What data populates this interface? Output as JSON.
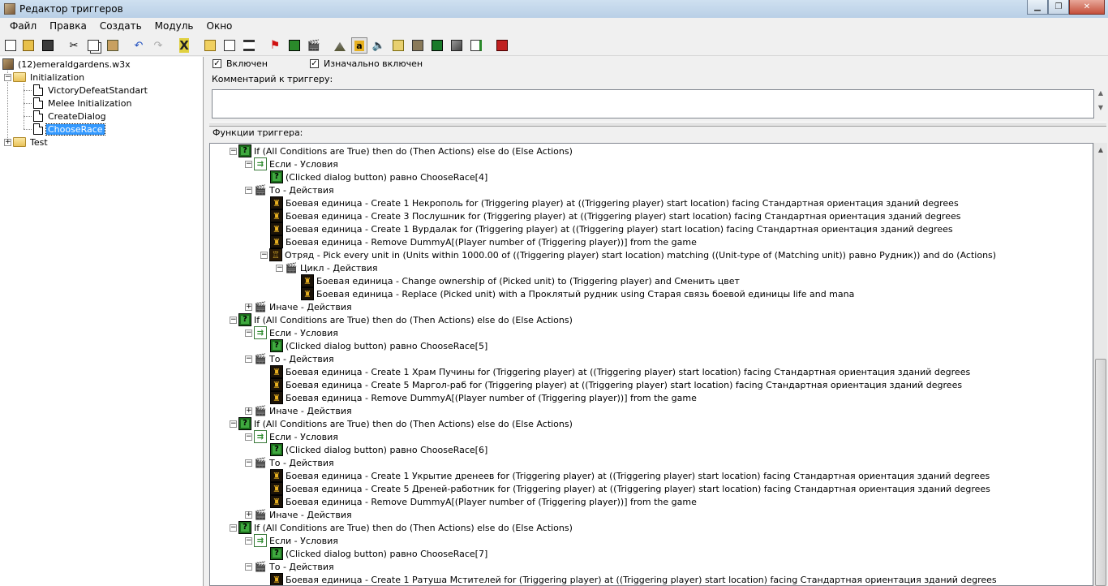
{
  "window": {
    "title": "Редактор триггеров"
  },
  "menu": [
    "Файл",
    "Правка",
    "Создать",
    "Модуль",
    "Окно"
  ],
  "tree": {
    "map": "(12)emeraldgardens.w3x",
    "folder1": "Initialization",
    "items": [
      "VictoryDefeatStandart",
      "Melee Initialization",
      "CreateDialog",
      "ChooseRace"
    ],
    "folder2": "Test"
  },
  "trigger": {
    "enabled_label": "Включен",
    "initially_enabled_label": "Изначально включен",
    "comment_label": "Комментарий к триггеру:",
    "comment_value": "",
    "functions_label": "Функции триггера:"
  },
  "rows": [
    {
      "t": "If (All Conditions are True) then do (Then Actions) else do (Else Actions)"
    },
    {
      "t": "Если - Условия"
    },
    {
      "t": "(Clicked dialog button) равно ChooseRace[4]"
    },
    {
      "t": "То - Действия"
    },
    {
      "t": "Боевая единица - Create 1 Некрополь for (Triggering player) at ((Triggering player) start location) facing Стандартная ориентация зданий degrees"
    },
    {
      "t": "Боевая единица - Create 3 Послушник for (Triggering player) at ((Triggering player) start location) facing Стандартная ориентация зданий degrees"
    },
    {
      "t": "Боевая единица - Create 1 Вурдалак for (Triggering player) at ((Triggering player) start location) facing Стандартная ориентация зданий degrees"
    },
    {
      "t": "Боевая единица - Remove DummyA[(Player number of (Triggering player))] from the game"
    },
    {
      "t": "Отряд - Pick every unit in (Units within 1000.00 of ((Triggering player) start location) matching ((Unit-type of (Matching unit)) равно Рудник)) and do (Actions)"
    },
    {
      "t": "Цикл - Действия"
    },
    {
      "t": "Боевая единица - Change ownership of (Picked unit) to (Triggering player) and Сменить цвет"
    },
    {
      "t": "Боевая единица - Replace (Picked unit) with a Проклятый рудник using Старая связь боевой единицы life and mana"
    },
    {
      "t": "Иначе - Действия"
    },
    {
      "t": "If (All Conditions are True) then do (Then Actions) else do (Else Actions)"
    },
    {
      "t": "Если - Условия"
    },
    {
      "t": "(Clicked dialog button) равно ChooseRace[5]"
    },
    {
      "t": "То - Действия"
    },
    {
      "t": "Боевая единица - Create 1 Храм Пучины for (Triggering player) at ((Triggering player) start location) facing Стандартная ориентация зданий degrees"
    },
    {
      "t": "Боевая единица - Create 5 Маргол-раб for (Triggering player) at ((Triggering player) start location) facing Стандартная ориентация зданий degrees"
    },
    {
      "t": "Боевая единица - Remove DummyA[(Player number of (Triggering player))] from the game"
    },
    {
      "t": "Иначе - Действия"
    },
    {
      "t": "If (All Conditions are True) then do (Then Actions) else do (Else Actions)"
    },
    {
      "t": "Если - Условия"
    },
    {
      "t": "(Clicked dialog button) равно ChooseRace[6]"
    },
    {
      "t": "То - Действия"
    },
    {
      "t": "Боевая единица - Create 1 Укрытие дренеев for (Triggering player) at ((Triggering player) start location) facing Стандартная ориентация зданий degrees"
    },
    {
      "t": "Боевая единица - Create 5 Дреней-работник for (Triggering player) at ((Triggering player) start location) facing Стандартная ориентация зданий degrees"
    },
    {
      "t": "Боевая единица - Remove DummyA[(Player number of (Triggering player))] from the game"
    },
    {
      "t": "Иначе - Действия"
    },
    {
      "t": "If (All Conditions are True) then do (Then Actions) else do (Else Actions)"
    },
    {
      "t": "Если - Условия"
    },
    {
      "t": "(Clicked dialog button) равно ChooseRace[7]"
    },
    {
      "t": "То - Действия"
    },
    {
      "t": "Боевая единица - Create 1 Ратуша Мстителей for (Triggering player) at ((Triggering player) start location) facing Стандартная ориентация зданий degrees"
    }
  ]
}
